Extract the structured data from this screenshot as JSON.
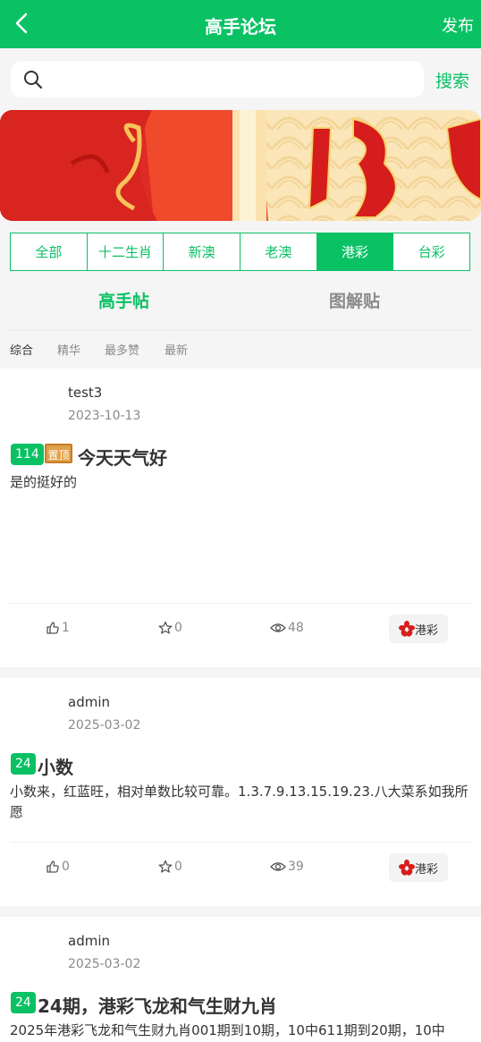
{
  "header": {
    "title": "高手论坛",
    "publish": "发布"
  },
  "search": {
    "placeholder": "",
    "button": "搜索"
  },
  "categories": [
    "全部",
    "十二生肖",
    "新澳",
    "老澳",
    "港彩",
    "台彩"
  ],
  "post_tabs": [
    "高手帖",
    "图解贴"
  ],
  "sorts": [
    "综合",
    "精华",
    "最多赞",
    "最新"
  ],
  "posts": [
    {
      "author": "test3",
      "date": "2023-10-13",
      "badge": "114",
      "pin": "置顶",
      "title": "今天天气好",
      "body": "是的挺好的",
      "likes": "1",
      "stars": "0",
      "views": "48",
      "tag": "港彩"
    },
    {
      "author": "admin",
      "date": "2025-03-02",
      "badge": "24",
      "title": "小数",
      "body": "小数来，红蓝旺，相对单数比较可靠。1.3.7.9.13.15.19.23.八大菜系如我所愿",
      "likes": "0",
      "stars": "0",
      "views": "39",
      "tag": "港彩"
    },
    {
      "author": "admin",
      "date": "2025-03-02",
      "badge": "24",
      "title": "24期，港彩飞龙和气生财九肖",
      "body": "2025年港彩飞龙和气生财九肖001期到10期，10中611期到20期，10中"
    }
  ]
}
